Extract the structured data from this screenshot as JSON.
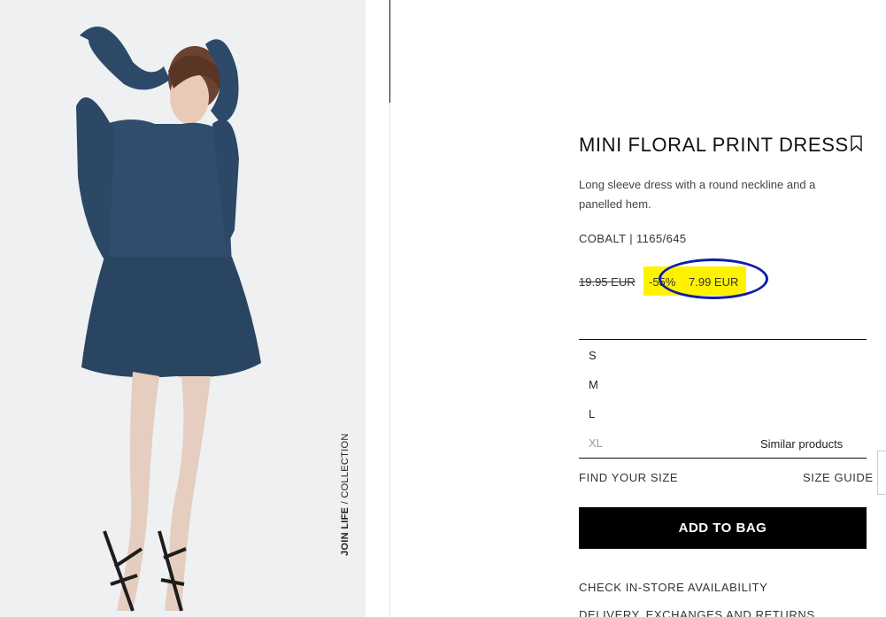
{
  "product": {
    "title": "MINI FLORAL PRINT DRESS",
    "description": "Long sleeve dress with a round neckline and a panelled hem.",
    "color_ref": "COBALT | 1165/645",
    "old_price": "19.95 EUR",
    "discount": "-55%",
    "price": "7.99 EUR"
  },
  "image": {
    "badge_bold": "JOIN LIFE",
    "badge_rest": " / COLLECTION"
  },
  "sizes": [
    {
      "label": "S",
      "available": true
    },
    {
      "label": "M",
      "available": true
    },
    {
      "label": "L",
      "available": true
    },
    {
      "label": "XL",
      "available": false
    }
  ],
  "similar_label": "Similar products",
  "find_size_label": "FIND YOUR SIZE",
  "size_guide_label": "SIZE GUIDE",
  "add_to_bag_label": "ADD TO BAG",
  "check_store_label": "CHECK IN-STORE AVAILABILITY",
  "delivery_label": "DELIVERY, EXCHANGES AND RETURNS",
  "colors": {
    "sale_highlight": "#fff200",
    "annotation": "#0d1ea8",
    "button": "#000000"
  }
}
